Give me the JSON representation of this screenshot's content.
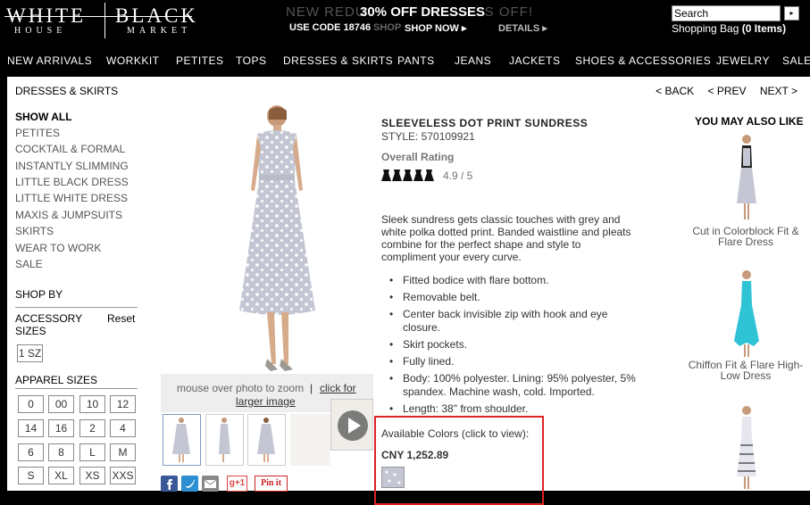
{
  "logo": {
    "white": "WHITE",
    "house": "HOUSE",
    "black": "BLACK",
    "market": "MARKET"
  },
  "promo": {
    "background_text": "NEW REDU",
    "background_text_tail": "S OFF!",
    "background_sub": "SHOP",
    "headline": "30% OFF DRESSES",
    "code": "USE CODE 18746",
    "shop_now": "SHOP NOW ▸",
    "details": "DETAILS ▸"
  },
  "search": {
    "placeholder": "Search",
    "button": "▸"
  },
  "bag": {
    "label": "Shopping Bag",
    "count": "(0 Items)"
  },
  "nav": [
    "NEW ARRIVALS",
    "WORKKIT",
    "PETITES",
    "TOPS",
    "DRESSES & SKIRTS",
    "PANTS",
    "JEANS",
    "JACKETS",
    "SHOES & ACCESSORIES",
    "JEWELRY",
    "SALE"
  ],
  "breadcrumb": "DRESSES & SKIRTS",
  "pager": {
    "back": "< BACK",
    "prev": "< PREV",
    "next": "NEXT >"
  },
  "sidebar": {
    "categories": [
      "SHOW ALL",
      "PETITES",
      "COCKTAIL & FORMAL",
      "INSTANTLY SLIMMING",
      "LITTLE BLACK DRESS",
      "LITTLE WHITE DRESS",
      "MAXIS & JUMPSUITS",
      "SKIRTS",
      "WEAR TO WORK",
      "SALE"
    ],
    "shop_by": "SHOP BY",
    "accessory": "ACCESSORY",
    "sizes_label": "SIZES",
    "reset": "Reset",
    "accessory_sizes": [
      "1 SZ"
    ],
    "apparel_sizes_label": "APPAREL SIZES",
    "apparel_sizes": [
      "0",
      "00",
      "10",
      "12",
      "14",
      "16",
      "2",
      "4",
      "6",
      "8",
      "L",
      "M",
      "S",
      "XL",
      "XS",
      "XXS"
    ]
  },
  "zoom": {
    "hint": "mouse over photo to zoom",
    "sep": "|",
    "link1": "click for",
    "link2": "larger image"
  },
  "product": {
    "title": "SLEEVELESS DOT PRINT SUNDRESS",
    "style": "STYLE: 570109921",
    "rating_label": "Overall Rating",
    "rating_value": "4.9 / 5",
    "rating": 4.9,
    "rating_max": 5,
    "description": "Sleek sundress gets classic touches with grey and white polka dotted print. Banded waistline and pleats combine for the perfect shape and style to compliment your every curve.",
    "bullets": [
      "Fitted bodice with flare bottom.",
      "Removable belt.",
      "Center back invisible zip with hook and eye closure.",
      "Skirt pockets.",
      "Fully lined.",
      "Body: 100% polyester. Lining: 95% polyester, 5% spandex. Machine wash, cold. Imported.",
      "Length: 38\" from shoulder."
    ],
    "colors_label": "Available Colors (click to view):",
    "price": "CNY 1,252.89"
  },
  "ymal": {
    "heading": "YOU MAY ALSO LIKE",
    "items": [
      {
        "name": "Cut in Colorblock Fit & Flare Dress"
      },
      {
        "name": "Chiffon Fit & Flare High-Low Dress"
      }
    ]
  },
  "social": {
    "pinit": "Pin it",
    "gplus": "g+1"
  },
  "colors": {
    "accent_red": "#d22222",
    "header_bg": "#000000",
    "dress_gray": "#c9ccd8",
    "teal_dress": "#2ec4d6"
  }
}
